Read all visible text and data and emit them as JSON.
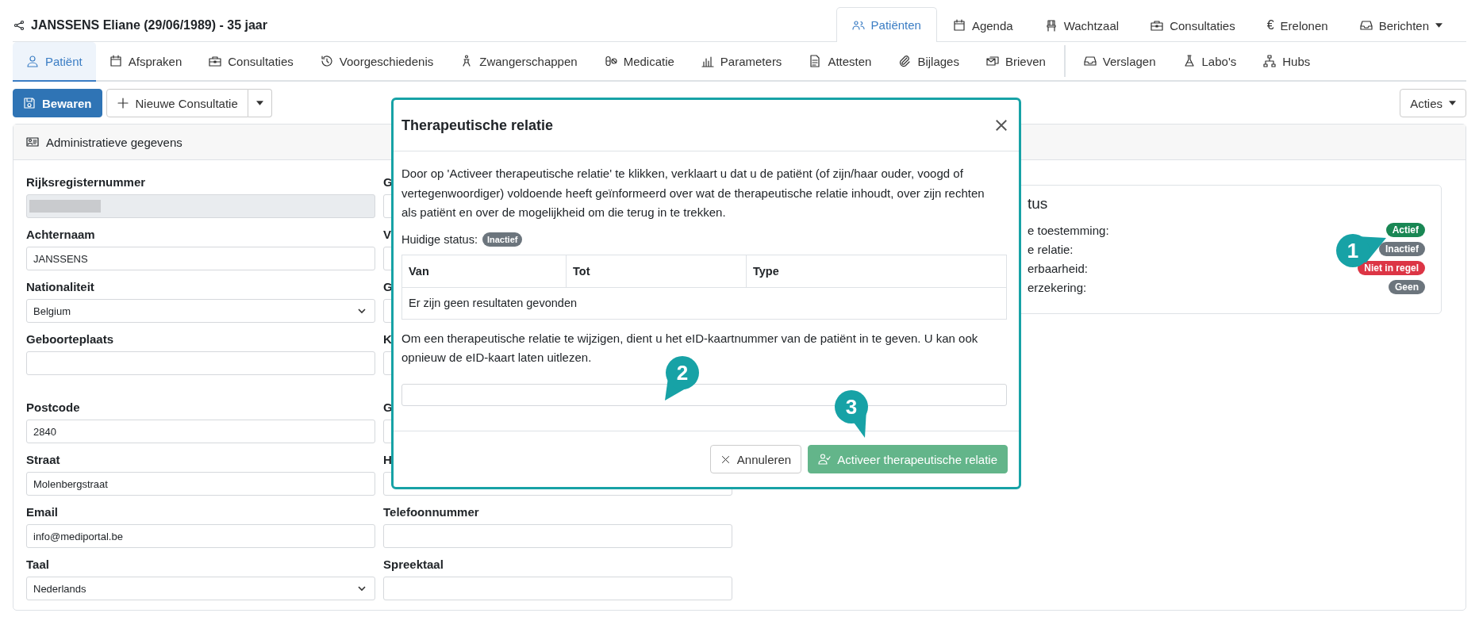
{
  "header": {
    "title": "JANSSENS Eliane (29/06/1989) - 35 jaar",
    "nav": [
      {
        "label": "Patiënten",
        "selected": true
      },
      {
        "label": "Agenda",
        "selected": false
      },
      {
        "label": "Wachtzaal",
        "selected": false
      },
      {
        "label": "Consultaties",
        "selected": false
      },
      {
        "label": "Erelonen",
        "selected": false,
        "symbol": "€"
      },
      {
        "label": "Berichten",
        "selected": false,
        "dropdown": true
      }
    ]
  },
  "subnav": [
    [
      {
        "label": "Patiënt",
        "selected": true
      },
      {
        "label": "Afspraken",
        "selected": false
      },
      {
        "label": "Consultaties",
        "selected": false
      },
      {
        "label": "Voorgeschiedenis",
        "selected": false
      },
      {
        "label": "Zwangerschappen",
        "selected": false
      },
      {
        "label": "Medicatie",
        "selected": false
      },
      {
        "label": "Parameters",
        "selected": false
      },
      {
        "label": "Attesten",
        "selected": false
      },
      {
        "label": "Bijlages",
        "selected": false
      },
      {
        "label": "Brieven",
        "selected": false
      }
    ],
    [
      {
        "label": "Verslagen",
        "selected": false
      },
      {
        "label": "Labo's",
        "selected": false
      },
      {
        "label": "Hubs",
        "selected": false
      }
    ]
  ],
  "toolbar": {
    "save": "Bewaren",
    "new": "Nieuwe Consultatie",
    "actions": "Acties"
  },
  "panel": {
    "title": "Administratieve gegevens",
    "sections": [
      [
        [
          {
            "label": "Rijksregisternummer",
            "kind": "redacted"
          },
          {
            "label": "G",
            "kind": "text"
          }
        ],
        [
          {
            "label": "Achternaam",
            "kind": "text",
            "value": "JANSSENS"
          },
          {
            "label": "V",
            "kind": "text"
          }
        ],
        [
          {
            "label": "Nationaliteit",
            "kind": "select",
            "value": "Belgium"
          },
          {
            "label": "G",
            "kind": "text"
          }
        ],
        [
          {
            "label": "Geboorteplaats",
            "kind": "text"
          },
          {
            "label": "K",
            "kind": "text"
          }
        ]
      ],
      [
        [
          {
            "label": "Postcode",
            "kind": "text",
            "value": "2840"
          },
          {
            "label": "G",
            "kind": "text"
          }
        ],
        [
          {
            "label": "Straat",
            "kind": "text",
            "value": "Molenbergstraat"
          },
          {
            "label": "H",
            "kind": "text"
          }
        ],
        [
          {
            "label": "Email",
            "kind": "text",
            "value": "info@mediportal.be"
          },
          {
            "label": "Telefoonnummer",
            "kind": "text"
          }
        ],
        [
          {
            "label": "Taal",
            "kind": "select",
            "value": "Nederlands"
          },
          {
            "label": "Spreektaal",
            "kind": "text"
          }
        ]
      ]
    ]
  },
  "status": {
    "title": "tus",
    "rows": [
      {
        "label": "e toestemming:",
        "badge": "Actief",
        "color": "#198754"
      },
      {
        "label": "e relatie:",
        "badge": "Inactief",
        "color": "#6c757d"
      },
      {
        "label": "erbaarheid:",
        "badge": "Niet in regel",
        "color": "#dc3545"
      },
      {
        "label": "erzekering:",
        "badge": "Geen",
        "color": "#6c757d"
      }
    ]
  },
  "modal": {
    "title": "Therapeutische relatie",
    "intro": "Door op 'Activeer therapeutische relatie' te klikken, verklaart u dat u de patiënt (of zijn/haar ouder, voogd of vertegenwoordiger) voldoende heeft geïnformeerd over wat de therapeutische relatie inhoudt, over zijn rechten als patiënt en over de mogelijkheid om die terug in te trekken.",
    "status_label": "Huidige status:",
    "status_badge": "Inactief",
    "table": {
      "columns": [
        "Van",
        "Tot",
        "Type"
      ],
      "empty_text": "Er zijn geen resultaten gevonden"
    },
    "instruction": "Om een therapeutische relatie te wijzigen, dient u het eID-kaartnummer van de patiënt in te geven. U kan ook opnieuw de eID-kaart laten uitlezen.",
    "cancel": "Annuleren",
    "confirm": "Activeer therapeutische relatie"
  },
  "markers": [
    {
      "number": "1"
    },
    {
      "number": "2"
    },
    {
      "number": "3"
    }
  ]
}
